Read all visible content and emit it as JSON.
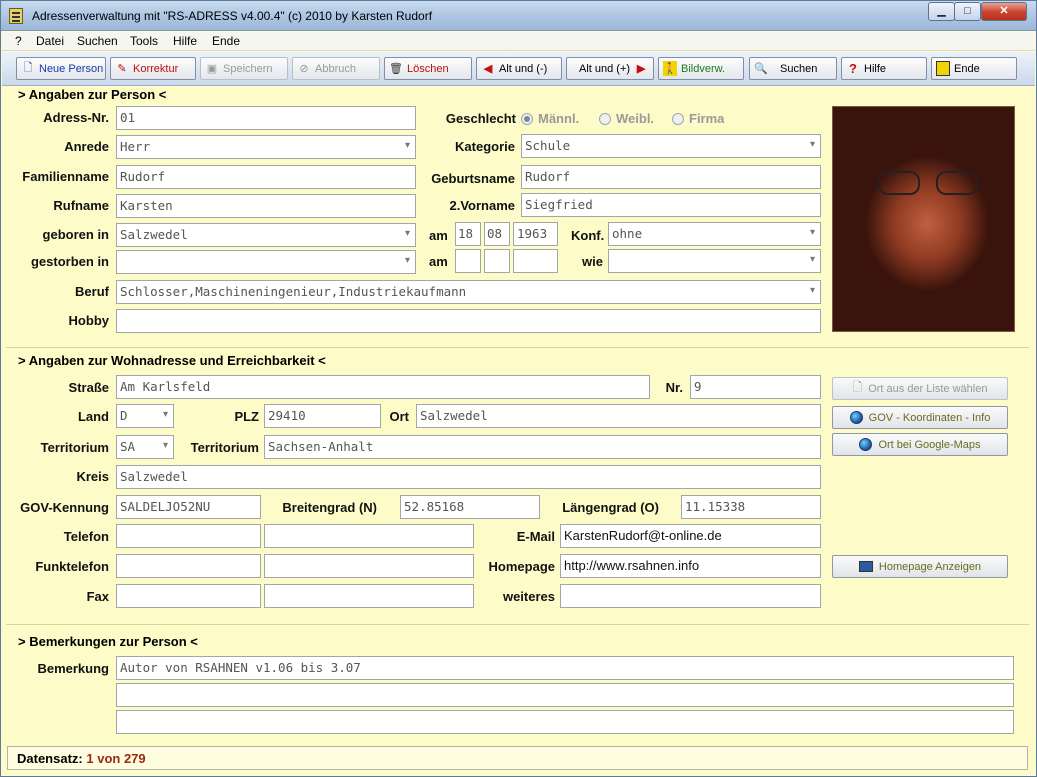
{
  "window": {
    "title": "Adressenverwaltung mit \"RS-ADRESS v4.00.4\" (c) 2010 by Karsten Rudorf"
  },
  "menu": [
    "?",
    "Datei",
    "Suchen",
    "Tools",
    "Hilfe",
    "Ende"
  ],
  "toolbar": {
    "neue_person": "Neue Person",
    "korrektur": "Korrektur",
    "speichern": "Speichern",
    "abbruch": "Abbruch",
    "loeschen": "Löschen",
    "alt_minus": "Alt und (-)",
    "alt_plus": "Alt und (+)",
    "bildverw": "Bildverw.",
    "suchen": "Suchen",
    "hilfe": "Hilfe",
    "ende": "Ende"
  },
  "person": {
    "section_title": "> Angaben zur Person <",
    "labels": {
      "adress_nr": "Adress-Nr.",
      "anrede": "Anrede",
      "familienname": "Familienname",
      "rufname": "Rufname",
      "geboren_in": "geboren in",
      "gestorben_in": "gestorben in",
      "beruf": "Beruf",
      "hobby": "Hobby",
      "geschlecht": "Geschlecht",
      "kategorie": "Kategorie",
      "geburtsname": "Geburtsname",
      "vorname2": "2.Vorname",
      "am": "am",
      "am2": "am",
      "konf": "Konf.",
      "wie": "wie"
    },
    "values": {
      "adress_nr": "01",
      "anrede": "Herr",
      "familienname": "Rudorf",
      "rufname": "Karsten",
      "geboren_in": "Salzwedel",
      "gestorben_in": "",
      "beruf": "Schlosser,Maschineningenieur,Industriekaufmann",
      "hobby": "",
      "kategorie": "Schule",
      "geburtsname": "Rudorf",
      "vorname2": "Siegfried",
      "geb_tag": "18",
      "geb_monat": "08",
      "geb_jahr": "1963",
      "konf": "ohne",
      "tod_tag": "",
      "tod_monat": "",
      "tod_jahr": "",
      "wie": ""
    },
    "gender": {
      "options": [
        "Männl.",
        "Weibl.",
        "Firma"
      ],
      "selected": "Männl."
    }
  },
  "address": {
    "section_title": "> Angaben zur Wohnadresse und Erreichbarkeit <",
    "labels": {
      "strasse": "Straße",
      "nr": "Nr.",
      "land": "Land",
      "plz": "PLZ",
      "ort": "Ort",
      "territorium": "Territorium",
      "territorium2": "Territorium",
      "kreis": "Kreis",
      "gov": "GOV-Kennung",
      "breitengrad": "Breitengrad (N)",
      "laengengrad": "Längengrad (O)",
      "telefon": "Telefon",
      "email": "E-Mail",
      "funktelefon": "Funktelefon",
      "homepage": "Homepage",
      "fax": "Fax",
      "weiteres": "weiteres"
    },
    "values": {
      "strasse": "Am Karlsfeld",
      "nr": "9",
      "land": "D",
      "plz": "29410",
      "ort": "Salzwedel",
      "territorium_code": "SA",
      "territorium": "Sachsen-Anhalt",
      "kreis": "Salzwedel",
      "gov": "SALDELJO52NU",
      "breitengrad": "52.85168",
      "laengengrad": "11.15338",
      "telefon": "",
      "telefon2": "",
      "email": "KarstenRudorf@t-online.de",
      "funktelefon": "",
      "funktelefon2": "",
      "homepage": "http://www.rsahnen.info",
      "fax": "",
      "fax2": "",
      "weiteres": ""
    },
    "buttons": {
      "ort_liste": "Ort aus der Liste wählen",
      "gov_info": "GOV - Koordinaten - Info",
      "google_maps": "Ort bei Google-Maps",
      "homepage_anzeigen": "Homepage Anzeigen"
    }
  },
  "remarks": {
    "section_title": "> Bemerkungen zur Person <",
    "label": "Bemerkung",
    "lines": [
      "Autor von RSAHNEN v1.06 bis 3.07",
      "",
      ""
    ]
  },
  "status": {
    "label": "Datensatz:",
    "value": "1 von 279"
  }
}
